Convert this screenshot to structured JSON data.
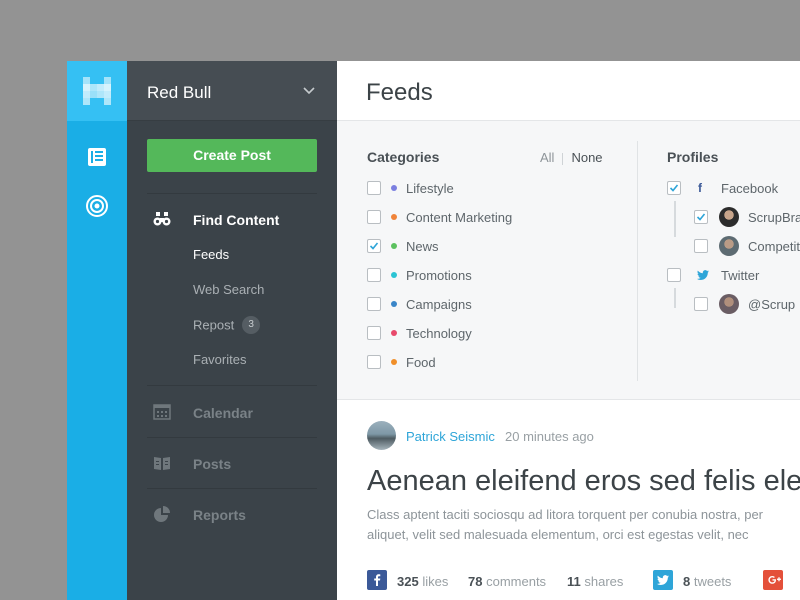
{
  "colors": {
    "rail": "#1aaee6",
    "sidebar": "#3b4349",
    "accent_green": "#54b85a",
    "link_blue": "#2ea5d8"
  },
  "rail": {
    "logo_icon": "logo-pixel-h",
    "icons": [
      "feeds-newspaper-icon",
      "target-icon"
    ]
  },
  "sidebar": {
    "brand": "Red Bull",
    "create_post": "Create Post",
    "find_content": {
      "label": "Find Content",
      "items": [
        {
          "label": "Feeds"
        },
        {
          "label": "Web Search"
        },
        {
          "label": "Repost",
          "badge": "3"
        },
        {
          "label": "Favorites"
        }
      ]
    },
    "sections": [
      {
        "label": "Calendar",
        "icon": "calendar-icon"
      },
      {
        "label": "Posts",
        "icon": "book-icon"
      },
      {
        "label": "Reports",
        "icon": "pie-chart-icon"
      }
    ]
  },
  "header": {
    "title": "Feeds"
  },
  "filters": {
    "categories": {
      "title": "Categories",
      "all": "All",
      "none": "None",
      "items": [
        {
          "label": "Lifestyle",
          "checked": false,
          "color": "#7b7fe0"
        },
        {
          "label": "Content Marketing",
          "checked": false,
          "color": "#f0843a"
        },
        {
          "label": "News",
          "checked": true,
          "color": "#5cc15f"
        },
        {
          "label": "Promotions",
          "checked": false,
          "color": "#2bc4d4"
        },
        {
          "label": "Campaigns",
          "checked": false,
          "color": "#3a86c8"
        },
        {
          "label": "Technology",
          "checked": false,
          "color": "#e84a6c"
        },
        {
          "label": "Food",
          "checked": false,
          "color": "#f08f2a"
        }
      ]
    },
    "profiles": {
      "title": "Profiles",
      "facebook": {
        "label": "Facebook",
        "checked": true
      },
      "facebook_children": [
        {
          "label": "ScrupBrand",
          "checked": true
        },
        {
          "label": "Competitor",
          "checked": false
        }
      ],
      "twitter": {
        "label": "Twitter",
        "checked": false
      },
      "twitter_children": [
        {
          "label": "@Scrup",
          "checked": false
        }
      ]
    }
  },
  "post": {
    "author": "Patrick Seismic",
    "time": "20 minutes ago",
    "title": "Aenean eleifend eros sed felis eleifend",
    "body_line1": "Class aptent taciti sociosqu ad litora torquent per conubia nostra, per",
    "body_line2": "aliquet, velit sed malesuada elementum, orci est egestas velit, nec",
    "stats": {
      "likes_count": "325",
      "likes_label": "likes",
      "comments_count": "78",
      "comments_label": "comments",
      "shares_count": "11",
      "shares_label": "shares",
      "tweets_count": "8",
      "tweets_label": "tweets"
    }
  }
}
